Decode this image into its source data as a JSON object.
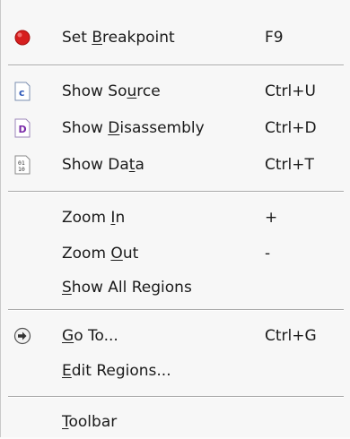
{
  "menu": {
    "items": [
      {
        "pre": "Set ",
        "acc": "B",
        "post": "reakpoint",
        "shortcut": "F9",
        "icon": "breakpoint-red-dot-icon"
      },
      {
        "pre": "Show So",
        "acc": "u",
        "post": "rce",
        "shortcut": "Ctrl+U",
        "icon": "source-c-file-icon",
        "glyph": "c"
      },
      {
        "pre": "Show ",
        "acc": "D",
        "post": "isassembly",
        "shortcut": "Ctrl+D",
        "icon": "disassembly-d-file-icon",
        "glyph": "D"
      },
      {
        "pre": "Show Da",
        "acc": "t",
        "post": "a",
        "shortcut": "Ctrl+T",
        "icon": "data-binary-file-icon",
        "glyph": "01\n10"
      },
      {
        "pre": "Zoom ",
        "acc": "I",
        "post": "n",
        "shortcut": "+"
      },
      {
        "pre": "Zoom ",
        "acc": "O",
        "post": "ut",
        "shortcut": "-"
      },
      {
        "pre": "",
        "acc": "S",
        "post": "how All Regions",
        "shortcut": ""
      },
      {
        "pre": "",
        "acc": "G",
        "post": "o To...",
        "shortcut": "Ctrl+G",
        "icon": "goto-arrow-circle-icon"
      },
      {
        "pre": "",
        "acc": "E",
        "post": "dit Regions...",
        "shortcut": ""
      },
      {
        "pre": "",
        "acc": "T",
        "post": "oolbar",
        "shortcut": ""
      }
    ]
  }
}
